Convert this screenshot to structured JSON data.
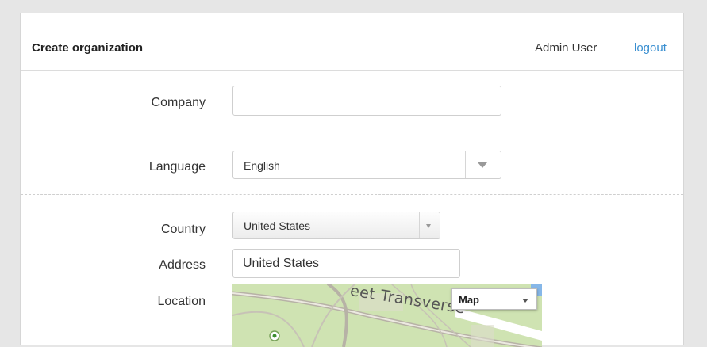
{
  "header": {
    "title": "Create organization",
    "user": "Admin User",
    "logout": "logout"
  },
  "form": {
    "company": {
      "label": "Company",
      "value": ""
    },
    "language": {
      "label": "Language",
      "value": "English"
    },
    "country": {
      "label": "Country",
      "value": "United States"
    },
    "address": {
      "label": "Address",
      "value": "United States"
    },
    "location": {
      "label": "Location"
    }
  },
  "map": {
    "type_label": "Map",
    "street_label": "eet Transverse"
  },
  "colors": {
    "link": "#3a8fd1",
    "map_park": "#cfe3b2",
    "map_water": "#86b7e8"
  }
}
